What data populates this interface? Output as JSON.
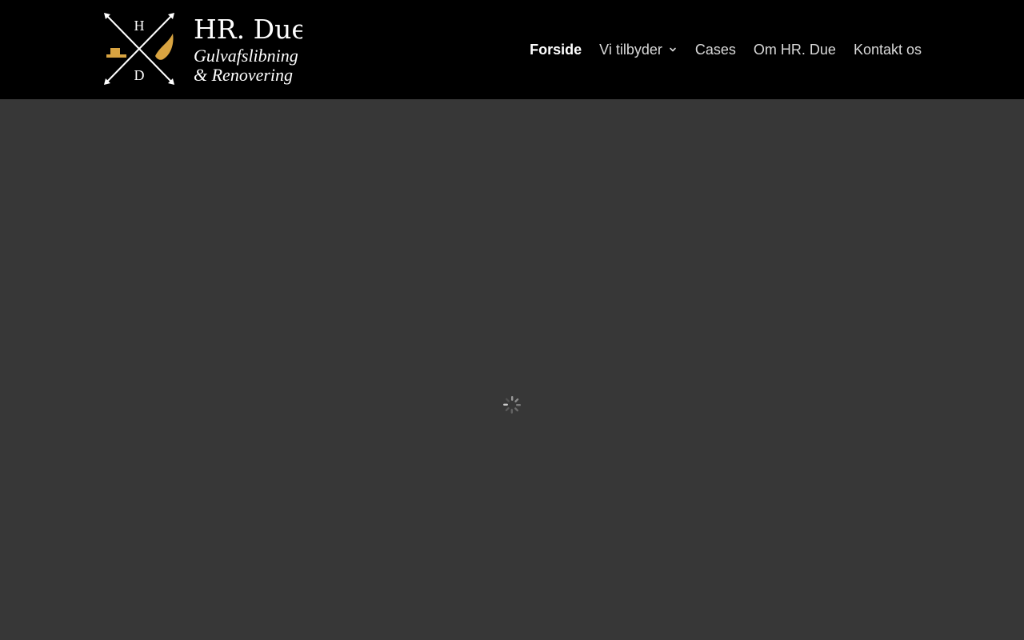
{
  "brand": {
    "logo_letter_top": "H",
    "logo_letter_bottom": "D",
    "name": "HR. Due",
    "tagline_line1": "Gulvafslibning",
    "tagline_line2": "& Renovering",
    "accent_color": "#d9a441"
  },
  "nav": {
    "items": [
      {
        "label": "Forside",
        "active": true
      },
      {
        "label": "Vi tilbyder",
        "has_dropdown": true
      },
      {
        "label": "Cases"
      },
      {
        "label": "Om HR. Due"
      },
      {
        "label": "Kontakt os"
      }
    ],
    "dropdown_icon": "chevron-down-icon"
  },
  "main": {
    "status_icon": "loading-spinner-icon",
    "background_color": "#373737"
  }
}
